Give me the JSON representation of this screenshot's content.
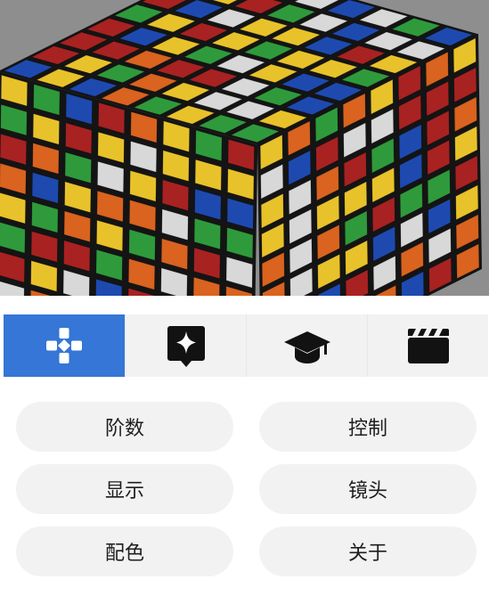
{
  "viewport": {
    "scene": "8x8-rubiks-cube",
    "colors": {
      "background": "#8e8e8e",
      "sticker_red": "#a82222",
      "sticker_orange": "#d9631f",
      "sticker_yellow": "#e8c22a",
      "sticker_green": "#2f9a3c",
      "sticker_blue": "#1e4ab0",
      "sticker_white": "#d8d8d8",
      "body": "#141414"
    }
  },
  "tabs": [
    {
      "icon": "gamepad-icon",
      "active": true
    },
    {
      "icon": "sparkle-bubble-icon",
      "active": false
    },
    {
      "icon": "graduation-cap-icon",
      "active": false
    },
    {
      "icon": "clapperboard-icon",
      "active": false
    }
  ],
  "accent_color": "#3576d6",
  "buttons": {
    "order": "阶数",
    "control": "控制",
    "display": "显示",
    "camera": "镜头",
    "color_scheme": "配色",
    "about": "关于"
  }
}
